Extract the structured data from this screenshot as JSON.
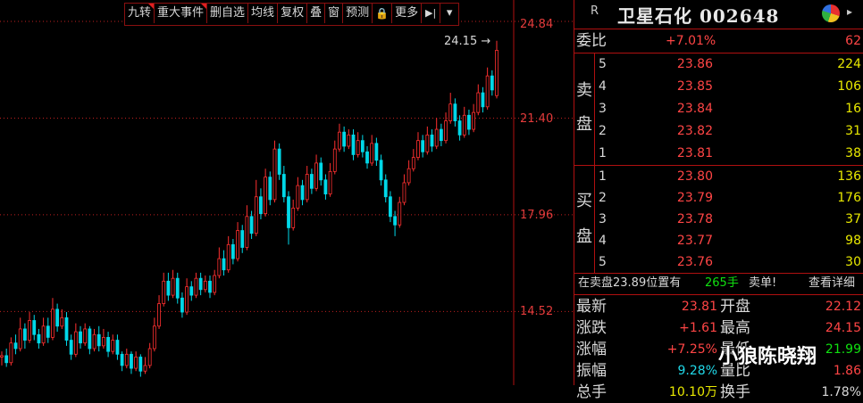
{
  "toolbar": {
    "items": [
      "九转",
      "重大事件",
      "删自选",
      "均线",
      "复权",
      "叠",
      "窗",
      "预测",
      "🔒",
      "更多"
    ],
    "flagged": [
      0,
      1
    ],
    "icon_next": "▶|",
    "icon_menu": "▾"
  },
  "price_axis": {
    "labels": [
      "24.84",
      "21.40",
      "17.96",
      "14.52"
    ],
    "annotation": "24.15"
  },
  "chart_data": {
    "type": "candlestick",
    "ylim": [
      11.9,
      25.6
    ],
    "gridlines": [
      24.84,
      21.4,
      17.96,
      14.52
    ],
    "high_annotation": 24.15,
    "colors": {
      "up": "#ff3030",
      "down": "#00d8e8",
      "grid": "#c02020"
    },
    "candles": [
      [
        12.9,
        12.95,
        12.6,
        13.1
      ],
      [
        12.95,
        12.7,
        12.55,
        13.2
      ],
      [
        12.7,
        13.4,
        12.6,
        13.6
      ],
      [
        13.4,
        13.2,
        13.0,
        13.7
      ],
      [
        13.2,
        13.9,
        13.1,
        14.3
      ],
      [
        13.9,
        13.5,
        13.2,
        14.1
      ],
      [
        13.5,
        14.2,
        13.4,
        14.5
      ],
      [
        14.2,
        13.7,
        13.5,
        14.4
      ],
      [
        13.7,
        13.4,
        13.2,
        13.9
      ],
      [
        13.4,
        14.0,
        13.3,
        14.3
      ],
      [
        14.0,
        13.6,
        13.4,
        14.3
      ],
      [
        13.6,
        14.6,
        13.5,
        15.0
      ],
      [
        14.6,
        14.0,
        13.8,
        14.8
      ],
      [
        14.0,
        14.3,
        13.9,
        14.6
      ],
      [
        14.3,
        13.5,
        13.3,
        14.5
      ],
      [
        13.5,
        13.0,
        12.8,
        13.7
      ],
      [
        13.0,
        13.8,
        12.9,
        14.1
      ],
      [
        13.8,
        13.4,
        13.2,
        14.0
      ],
      [
        13.4,
        13.9,
        13.3,
        14.1
      ],
      [
        13.9,
        13.2,
        13.0,
        14.0
      ],
      [
        13.2,
        13.7,
        13.1,
        13.9
      ],
      [
        13.7,
        13.3,
        13.1,
        14.0
      ],
      [
        13.3,
        13.6,
        13.2,
        13.9
      ],
      [
        13.6,
        13.1,
        12.9,
        13.8
      ],
      [
        13.1,
        13.5,
        13.0,
        13.7
      ],
      [
        13.5,
        13.0,
        12.8,
        13.7
      ],
      [
        13.0,
        12.6,
        12.4,
        13.1
      ],
      [
        12.6,
        13.0,
        12.5,
        13.2
      ],
      [
        13.0,
        12.5,
        12.3,
        13.1
      ],
      [
        12.5,
        12.9,
        12.4,
        13.1
      ],
      [
        12.9,
        12.4,
        12.2,
        13.0
      ],
      [
        12.4,
        12.6,
        12.3,
        12.9
      ],
      [
        12.6,
        13.2,
        12.5,
        13.4
      ],
      [
        13.2,
        14.0,
        13.1,
        14.3
      ],
      [
        14.0,
        14.8,
        13.9,
        15.1
      ],
      [
        14.8,
        15.6,
        14.7,
        15.9
      ],
      [
        15.6,
        15.1,
        14.9,
        15.9
      ],
      [
        15.1,
        15.7,
        15.0,
        16.0
      ],
      [
        15.7,
        15.0,
        14.8,
        15.9
      ],
      [
        15.0,
        14.5,
        14.3,
        15.2
      ],
      [
        14.5,
        15.4,
        14.4,
        15.7
      ],
      [
        15.4,
        15.1,
        14.9,
        15.6
      ],
      [
        15.1,
        15.7,
        15.0,
        15.9
      ],
      [
        15.7,
        15.3,
        15.1,
        15.9
      ],
      [
        15.3,
        15.6,
        15.2,
        15.8
      ],
      [
        15.6,
        15.2,
        15.0,
        15.8
      ],
      [
        15.2,
        15.8,
        15.1,
        16.0
      ],
      [
        15.8,
        16.4,
        15.7,
        16.8
      ],
      [
        16.4,
        16.0,
        15.8,
        16.7
      ],
      [
        16.0,
        16.9,
        15.9,
        17.2
      ],
      [
        16.9,
        16.4,
        16.2,
        17.1
      ],
      [
        16.4,
        17.4,
        16.3,
        17.7
      ],
      [
        17.4,
        16.8,
        16.6,
        17.6
      ],
      [
        16.8,
        17.9,
        16.7,
        18.3
      ],
      [
        17.9,
        17.3,
        17.1,
        18.1
      ],
      [
        17.3,
        18.6,
        17.2,
        19.2
      ],
      [
        18.6,
        18.0,
        17.8,
        18.9
      ],
      [
        18.0,
        19.3,
        17.9,
        19.6
      ],
      [
        19.3,
        18.5,
        18.3,
        19.5
      ],
      [
        18.5,
        20.3,
        18.4,
        20.6
      ],
      [
        20.3,
        19.4,
        19.2,
        20.5
      ],
      [
        19.4,
        18.6,
        18.4,
        19.7
      ],
      [
        18.6,
        17.5,
        16.9,
        18.8
      ],
      [
        17.5,
        18.2,
        17.4,
        18.5
      ],
      [
        18.2,
        19.0,
        18.1,
        19.3
      ],
      [
        19.0,
        18.5,
        18.3,
        19.2
      ],
      [
        18.5,
        19.4,
        18.4,
        19.7
      ],
      [
        19.4,
        18.9,
        18.7,
        19.6
      ],
      [
        18.9,
        19.8,
        18.8,
        20.1
      ],
      [
        19.8,
        19.2,
        19.0,
        20.0
      ],
      [
        19.2,
        18.7,
        18.5,
        19.4
      ],
      [
        18.7,
        19.5,
        18.6,
        19.8
      ],
      [
        19.5,
        20.3,
        19.4,
        20.6
      ],
      [
        20.3,
        20.9,
        20.2,
        21.2
      ],
      [
        20.9,
        20.4,
        20.2,
        21.1
      ],
      [
        20.4,
        20.8,
        20.3,
        21.0
      ],
      [
        20.8,
        20.1,
        19.9,
        21.0
      ],
      [
        20.1,
        20.6,
        20.0,
        20.9
      ],
      [
        20.6,
        20.2,
        20.0,
        20.8
      ],
      [
        20.2,
        19.8,
        19.6,
        20.4
      ],
      [
        19.8,
        20.5,
        19.7,
        20.8
      ],
      [
        20.5,
        19.9,
        19.7,
        20.7
      ],
      [
        19.9,
        19.2,
        19.0,
        20.1
      ],
      [
        19.2,
        18.6,
        18.4,
        19.4
      ],
      [
        18.6,
        17.9,
        17.7,
        18.8
      ],
      [
        17.9,
        17.6,
        17.2,
        18.1
      ],
      [
        17.6,
        18.4,
        17.5,
        18.6
      ],
      [
        18.4,
        19.1,
        18.3,
        19.4
      ],
      [
        19.1,
        19.6,
        19.0,
        19.9
      ],
      [
        19.6,
        20.0,
        19.5,
        20.3
      ],
      [
        20.0,
        20.6,
        19.9,
        20.9
      ],
      [
        20.6,
        20.2,
        20.0,
        20.8
      ],
      [
        20.2,
        20.8,
        20.1,
        21.1
      ],
      [
        20.8,
        20.4,
        20.2,
        21.0
      ],
      [
        20.4,
        21.0,
        20.3,
        21.4
      ],
      [
        21.0,
        20.6,
        20.4,
        21.2
      ],
      [
        20.6,
        21.3,
        20.5,
        21.6
      ],
      [
        21.3,
        21.9,
        21.2,
        22.3
      ],
      [
        21.9,
        21.3,
        21.1,
        22.1
      ],
      [
        21.3,
        20.8,
        20.6,
        21.5
      ],
      [
        20.8,
        21.5,
        20.7,
        21.8
      ],
      [
        21.5,
        21.0,
        20.8,
        21.7
      ],
      [
        21.0,
        21.6,
        20.9,
        21.9
      ],
      [
        21.6,
        22.3,
        21.5,
        22.6
      ],
      [
        22.3,
        21.8,
        21.6,
        22.5
      ],
      [
        21.8,
        22.9,
        21.7,
        23.2
      ],
      [
        22.9,
        22.4,
        22.2,
        23.1
      ],
      [
        22.2,
        23.81,
        22.1,
        24.15
      ]
    ]
  },
  "panel": {
    "market": "R",
    "title": "卫星石化 002648",
    "weibi": {
      "label": "委比",
      "pct": "+7.01%",
      "diff": "62"
    },
    "sell_label": [
      "卖",
      "盘"
    ],
    "buy_label": [
      "买",
      "盘"
    ],
    "asks": [
      {
        "lvl": "5",
        "price": "23.86",
        "vol": "224"
      },
      {
        "lvl": "4",
        "price": "23.85",
        "vol": "106"
      },
      {
        "lvl": "3",
        "price": "23.84",
        "vol": "16"
      },
      {
        "lvl": "2",
        "price": "23.82",
        "vol": "31"
      },
      {
        "lvl": "1",
        "price": "23.81",
        "vol": "38"
      }
    ],
    "bids": [
      {
        "lvl": "1",
        "price": "23.80",
        "vol": "136"
      },
      {
        "lvl": "2",
        "price": "23.79",
        "vol": "176"
      },
      {
        "lvl": "3",
        "price": "23.78",
        "vol": "37"
      },
      {
        "lvl": "4",
        "price": "23.77",
        "vol": "98"
      },
      {
        "lvl": "5",
        "price": "23.76",
        "vol": "30"
      }
    ],
    "order_msg": {
      "prefix": "在卖盘23.89位置有",
      "vol": "265手",
      "type": "卖单!",
      "link": "查看详细"
    },
    "stats": [
      {
        "l1": "最新",
        "v1": "23.81",
        "c1": "red",
        "l2": "开盘",
        "v2": "22.12",
        "c2": "red"
      },
      {
        "l1": "涨跌",
        "v1": "+1.61",
        "c1": "red",
        "l2": "最高",
        "v2": "24.15",
        "c2": "red"
      },
      {
        "l1": "涨幅",
        "v1": "+7.25%",
        "c1": "red",
        "l2": "最低",
        "v2": "21.99",
        "c2": "green"
      },
      {
        "l1": "振幅",
        "v1": "9.28%",
        "c1": "cyan",
        "l2": "量比",
        "v2": "1.86",
        "c2": "red"
      },
      {
        "l1": "总手",
        "v1": "10.10万",
        "c1": "yellow",
        "l2": "换手",
        "v2": "1.78%",
        "c2": "white"
      }
    ]
  },
  "watermark": "小狼陈晓翔"
}
